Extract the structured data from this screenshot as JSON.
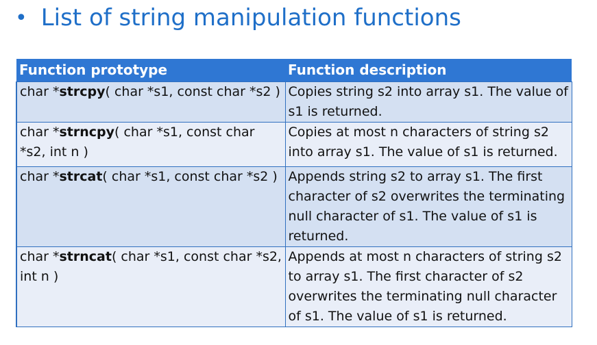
{
  "title": {
    "bullet": "•",
    "text": "List of string manipulation functions"
  },
  "table": {
    "headers": [
      "Function prototype",
      "Function description"
    ],
    "rows": [
      {
        "prefix": "char *",
        "name": "strcpy",
        "params": "( char *s1, const char *s2 )",
        "description": "Copies string s2 into array s1. The value of s1 is returned."
      },
      {
        "prefix": "char *",
        "name": "strncpy",
        "params": "( char *s1, const char *s2, int n )",
        "description": "Copies at most n characters of string s2 into array s1. The value of s1 is returned."
      },
      {
        "prefix": "char *",
        "name": "strcat",
        "params": "( char *s1, const char *s2 )",
        "description": "Appends string s2 to array s1. The first character of s2 overwrites the terminating null character of s1. The value of s1 is returned."
      },
      {
        "prefix": "char *",
        "name": "strncat",
        "params": "( char *s1, const char *s2, int n )",
        "description": "Appends at most n characters of string s2 to array s1. The first character of s2 overwrites the terminating null character of s1. The value of s1 is returned."
      }
    ]
  }
}
